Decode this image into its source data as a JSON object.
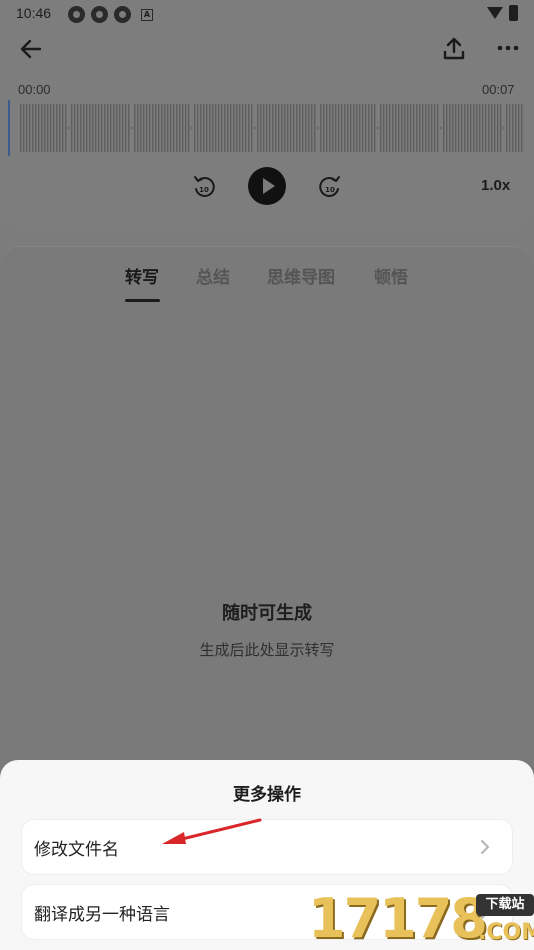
{
  "status_bar": {
    "time": "10:46",
    "badge": "A"
  },
  "player": {
    "time_start": "00:00",
    "time_end": "00:07",
    "speed": "1.0x"
  },
  "tabs": [
    {
      "label": "转写",
      "active": true
    },
    {
      "label": "总结",
      "active": false
    },
    {
      "label": "思维导图",
      "active": false
    },
    {
      "label": "顿悟",
      "active": false
    }
  ],
  "empty_state": {
    "title": "随时可生成",
    "subtitle": "生成后此处显示转写"
  },
  "sheet": {
    "title": "更多操作",
    "items": [
      {
        "label": "修改文件名"
      },
      {
        "label": "翻译成另一种语言"
      }
    ]
  },
  "watermark": {
    "digits": "17178",
    "badge": "下载站",
    "suffix": ".COM"
  },
  "colors": {
    "overlay": "#7c7c7c",
    "sheet": "#f7f7f7",
    "arrow": "#d9262a",
    "watermark": "#e9c15a"
  }
}
